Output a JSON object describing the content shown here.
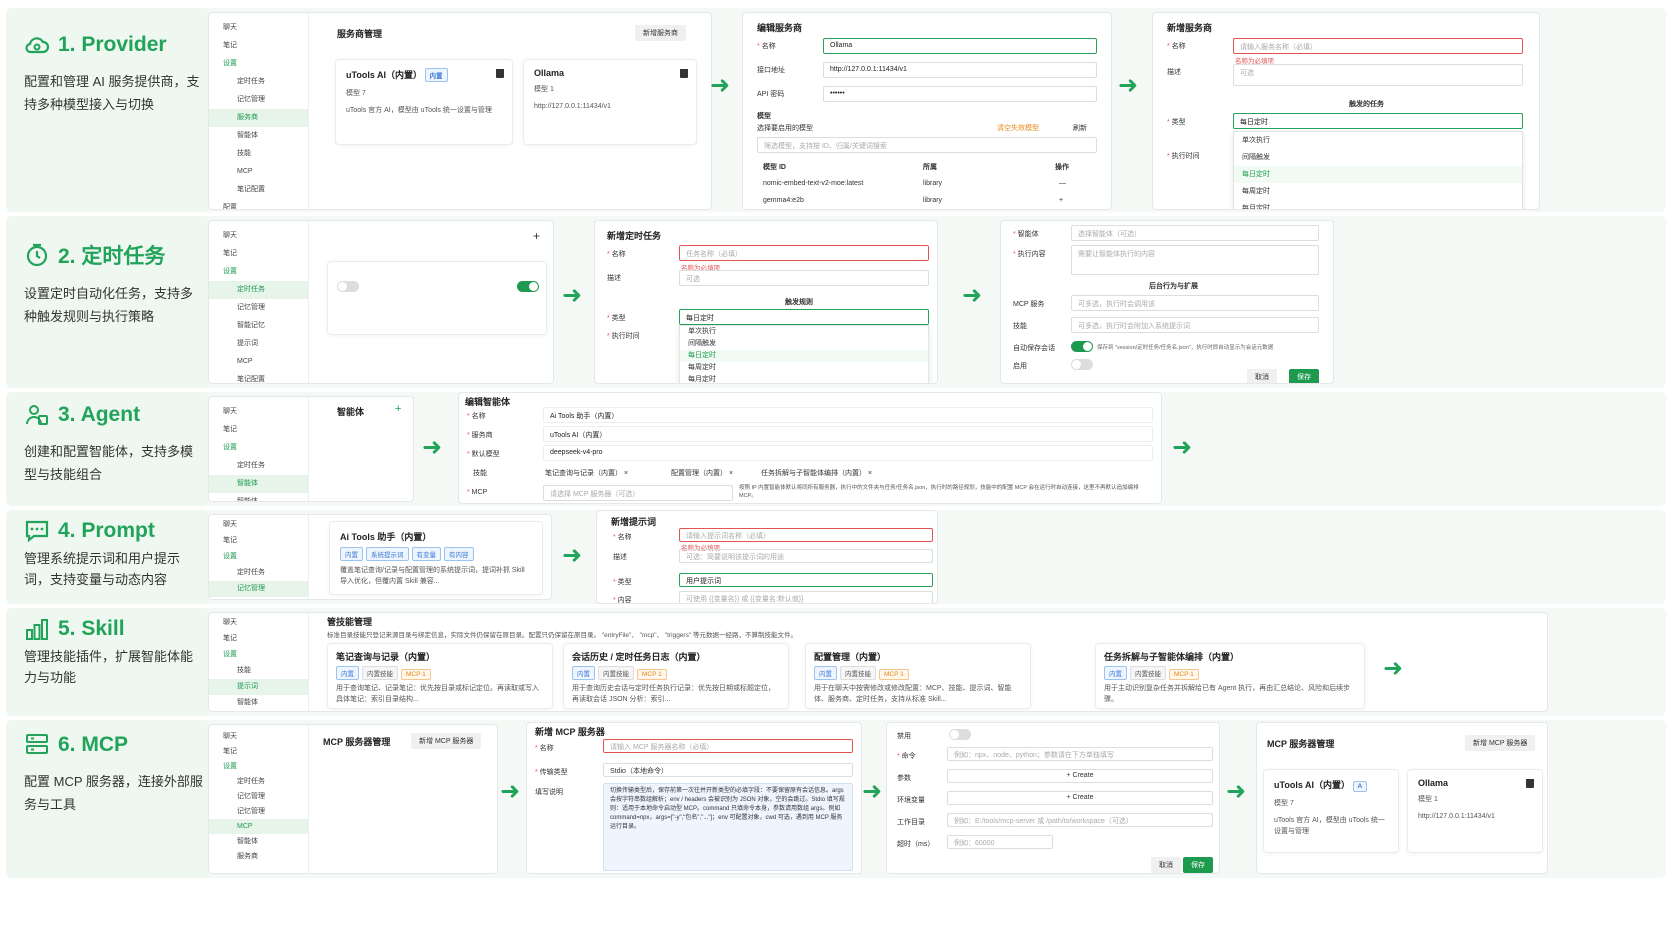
{
  "rows": [
    {
      "title": "1. Provider",
      "desc": "配置和管理 AI 服务提供商，支持多种模型接入与切换"
    },
    {
      "title": "2. 定时任务",
      "desc": "设置定时自动化任务，支持多种触发规则与执行策略"
    },
    {
      "title": "3. Agent",
      "desc": "创建和配置智能体，支持多模型与技能组合"
    },
    {
      "title": "4. Prompt",
      "desc": "管理系统提示词和用户提示词，支持变量与动态内容"
    },
    {
      "title": "5. Skill",
      "desc": "管理技能插件，扩展智能体能力与功能"
    },
    {
      "title": "6. MCP",
      "desc": "配置 MCP 服务器，连接外部服务与工具"
    }
  ],
  "sidebar": {
    "chat": "聊天",
    "notes": "笔记",
    "settings": "设置",
    "scheduled": "定时任务",
    "memory": "记忆管理",
    "provider": "服务商",
    "agent": "智能体",
    "skill": "技能",
    "mcp": "MCP",
    "note_config": "笔记配置",
    "config": "配置",
    "smart_memory": "智能记忆",
    "prompt": "提示词"
  },
  "r1": {
    "panel_title": "服务商管理",
    "add_btn": "新增服务商",
    "card1": {
      "name": "uTools AI（内置）",
      "badge": "内置",
      "models": "模型 7",
      "desc": "uTools 官方 AI，模型由 uTools 统一设置与管理"
    },
    "card2": {
      "name": "Ollama",
      "models": "模型 1",
      "url": "http://127.0.0.1:11434/v1"
    },
    "edit": {
      "title": "编辑服务商",
      "name_label": "名称",
      "name_val": "Ollama",
      "url_label": "接口地址",
      "url_val": "http://127.0.0.1:11434/v1",
      "key_label": "API 密码",
      "key_val": "••••••",
      "model_label": "模型",
      "model_sub": "选择要启用的模型",
      "fail_link": "清空失效模型",
      "refresh": "刷新",
      "search_ph": "筛选模型，支持按 ID、归属/关键词搜索",
      "col_id": "模型 ID",
      "col_owner": "所属",
      "col_op": "操作",
      "m1": "nomic-embed-text-v2-moe:latest",
      "o1": "library",
      "op1": "—",
      "m2": "gemma4:e2b",
      "o2": "library",
      "op2": "+"
    },
    "add": {
      "title": "新增服务商",
      "name_label": "名称",
      "name_ph": "请输入服务名称（必填）",
      "err": "名称为必填项",
      "desc_label": "描述",
      "desc_ph": "可选",
      "section": "触发的任务",
      "type_label": "类型",
      "type_val": "每日定时",
      "time_label": "执行时间",
      "opts": [
        "单次执行",
        "间隔触发",
        "每日定时",
        "每周定时",
        "每月定时"
      ]
    }
  },
  "r2": {
    "new": {
      "title": "新增定时任务",
      "name_label": "名称",
      "name_ph": "任务名称（必填）",
      "err": "名称为必填项",
      "desc_label": "描述",
      "desc_ph": "可选",
      "section": "触发规则",
      "type_label": "类型",
      "type_val": "每日定时",
      "time_label": "执行时间",
      "opts": [
        "单次执行",
        "间隔触发",
        "每日定时",
        "每周定时",
        "每月定时"
      ]
    },
    "cfg": {
      "agent_label": "智能体",
      "agent_ph": "选择智能体（可选）",
      "exec_label": "执行内容",
      "exec_ph": "需要让智能体执行的内容",
      "section": "后台行为与扩展",
      "mcp_label": "MCP 服务",
      "mcp_ph": "可多选，执行时会调用该",
      "skill_label": "技能",
      "skill_ph": "可多选，执行时会附加入系统提示词",
      "save_label": "自动保存会话",
      "save_note": "保存到 \"session/定时任务/任务名.json\"，执行时即自动显示为会话元数据",
      "enable_label": "启用",
      "cancel": "取消",
      "save": "保存"
    }
  },
  "r3": {
    "panel_title": "智能体",
    "edit_title": "编辑智能体",
    "name_label": "名称",
    "name_val": "Ai Tools 助手（内置）",
    "prov_label": "服务商",
    "prov_val": "uTools AI（内置）",
    "model_label": "默认模型",
    "model_val": "deepseek-v4-pro",
    "skill_label": "技能",
    "skills": [
      "笔记查询与记录（内置）",
      "配置管理（内置）",
      "任务拆解与子智能体编排（内置）"
    ],
    "mcp_label": "MCP",
    "mcp_ph": "请选择 MCP 服务器（可选）",
    "mcp_note": "按照 IP 内置智能体默认将同所有服务器，执行中的文件夹与任务/任务名.json，执行时的路径规划，技能中的配置 MCP 会在运行时自动连接，这里不再默认追加编排 MCP。"
  },
  "r4": {
    "card_title": "Ai Tools 助手（内置）",
    "tags": [
      "内置",
      "系统提示词",
      "有变量",
      "有内容"
    ],
    "card_desc": "覆盖笔记查询/记录与配置管理的系统提示词，提词补抓 Skill 导入优化，但覆内置 Skill 兼容...",
    "new_title": "新增提示词",
    "name_label": "名称",
    "name_ph": "请输入提示词名称（必填）",
    "err": "名称为必填项",
    "desc_label": "描述",
    "desc_ph": "可选：简要说明该提示词的用途",
    "type_label": "类型",
    "type_val": "用户提示词",
    "content_label": "内容",
    "content_ph": "可使用 {{变量名}} 或 {{变量名:默认值}}"
  },
  "r5": {
    "title": "管技能管理",
    "note": "标准目录技能只登记来源目录与绑定信息，实际文件仍保留在原目录。配置只仍保留在原目录。 \"entryFile\"、 \"mcp\"、 \"triggers\" 等元数据一经路，不算制技能文件。",
    "cards": [
      {
        "name": "笔记查询与记录（内置）",
        "tags": [
          "内置",
          "内置技能",
          "MCP 1"
        ],
        "desc": "用于查询笔记、记录笔记：优先按目录或标记定位。再读取或写入具体笔记：索引目录结构..."
      },
      {
        "name": "会话历史 / 定时任务日志（内置）",
        "tags": [
          "内置",
          "内置技能",
          "MCP 1"
        ],
        "desc": "用于查询历史会话与定时任务执行记录：优先按日期或标题定位，再读取会话 JSON 分析：索引..."
      },
      {
        "name": "配置管理（内置）",
        "tags": [
          "内置",
          "内置技能",
          "MCP 1"
        ],
        "desc": "用于在聊天中按需修改或修改配置：MCP、技能、提示词、智能体、服务商、定时任务，支持从标准 Skill..."
      },
      {
        "name": "任务拆解与子智能体编排（内置）",
        "tags": [
          "内置",
          "内置技能",
          "MCP 1"
        ],
        "desc": "用于主动识别复杂任务并拆解给已有 Agent 执行，再由汇总结论、风险和后续步骤。"
      }
    ]
  },
  "r6": {
    "panel_title": "MCP 服务器管理",
    "add_btn": "新增 MCP 服务器",
    "new": {
      "title": "新增 MCP 服务器",
      "name_label": "名称",
      "name_ph": "请输入 MCP 服务器名称（必填）",
      "type_label": "传输类型",
      "type_val": "Stdio（本地命令）",
      "help_label": "填写说明",
      "help": "切换传输类型后，保存前第一次往并开新类型的必填字段：不要保留原有会话信息。args 会按字符串数组解析；env / headers 会被识别为 JSON 对象，空的会跳过。Stdio 填写规则：适用于本地命令启动型 MCP。command 只填命令本身，参数请用数组 args。例如 command=npx，args=[\"-y\",\"包名\",\"...\"]；env 可配置对象，cwd 可选，遇到用 MCP 服务运行目录。"
    },
    "cfg": {
      "disabled_label": "禁用",
      "cmd_label": "命令",
      "cmd_ph": "例如：npx、node、python；参数请在下方单独填写",
      "args_label": "参数",
      "create": "+ Create",
      "env_label": "环境变量",
      "dir_label": "工作目录",
      "dir_ph": "例如：E:/tools/mcp-server 或 /path/to/workspace（可选）",
      "timeout_label": "超时（ms）",
      "timeout_ph": "例如：60000",
      "cancel": "取消",
      "save": "保存"
    },
    "list": {
      "title": "MCP 服务器管理",
      "add_btn": "新增 MCP 服务器",
      "c1_name": "uTools AI（内置）",
      "c1_models": "模型 7",
      "c1_desc": "uTools 官方 AI，模型由 uTools 统一设置与管理",
      "c2_name": "Ollama",
      "c2_models": "模型 1",
      "c2_url": "http://127.0.0.1:11434/v1"
    }
  }
}
